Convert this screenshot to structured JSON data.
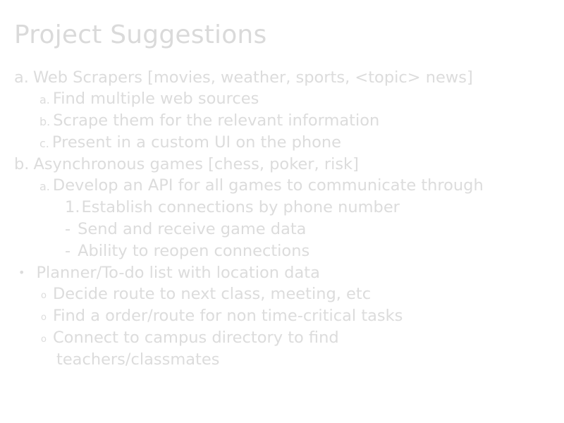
{
  "slide": {
    "title": "Project Suggestions",
    "text_color": "#dcdcdc",
    "background_color": "#ffffff"
  },
  "items": [
    {
      "marker": "a.",
      "text": "Web Scrapers [movies, weather, sports, <topic> news]"
    },
    {
      "marker": "a.",
      "text": "Find multiple web sources"
    },
    {
      "marker": "b.",
      "text": "Scrape them for the relevant information"
    },
    {
      "marker": "c.",
      "text": "Present in a custom UI on the phone"
    },
    {
      "marker": "b.",
      "text": "Asynchronous games [chess, poker, risk]"
    },
    {
      "marker": "a.",
      "text": "Develop an API for all games to communicate through"
    },
    {
      "marker": "1.",
      "text": "Establish connections by phone number"
    },
    {
      "marker": "-",
      "text": "Send and receive game data"
    },
    {
      "marker": "-",
      "text": "Ability to reopen connections"
    },
    {
      "marker": "•",
      "text": "Planner/To-do list with location data"
    },
    {
      "marker": "o",
      "text": "Decide route to next class, meeting, etc"
    },
    {
      "marker": "o",
      "text": "Find a order/route for non time-critical tasks"
    },
    {
      "marker": "o",
      "text": "Connect to campus directory to find"
    },
    {
      "marker": "",
      "text": "teachers/classmates"
    }
  ]
}
